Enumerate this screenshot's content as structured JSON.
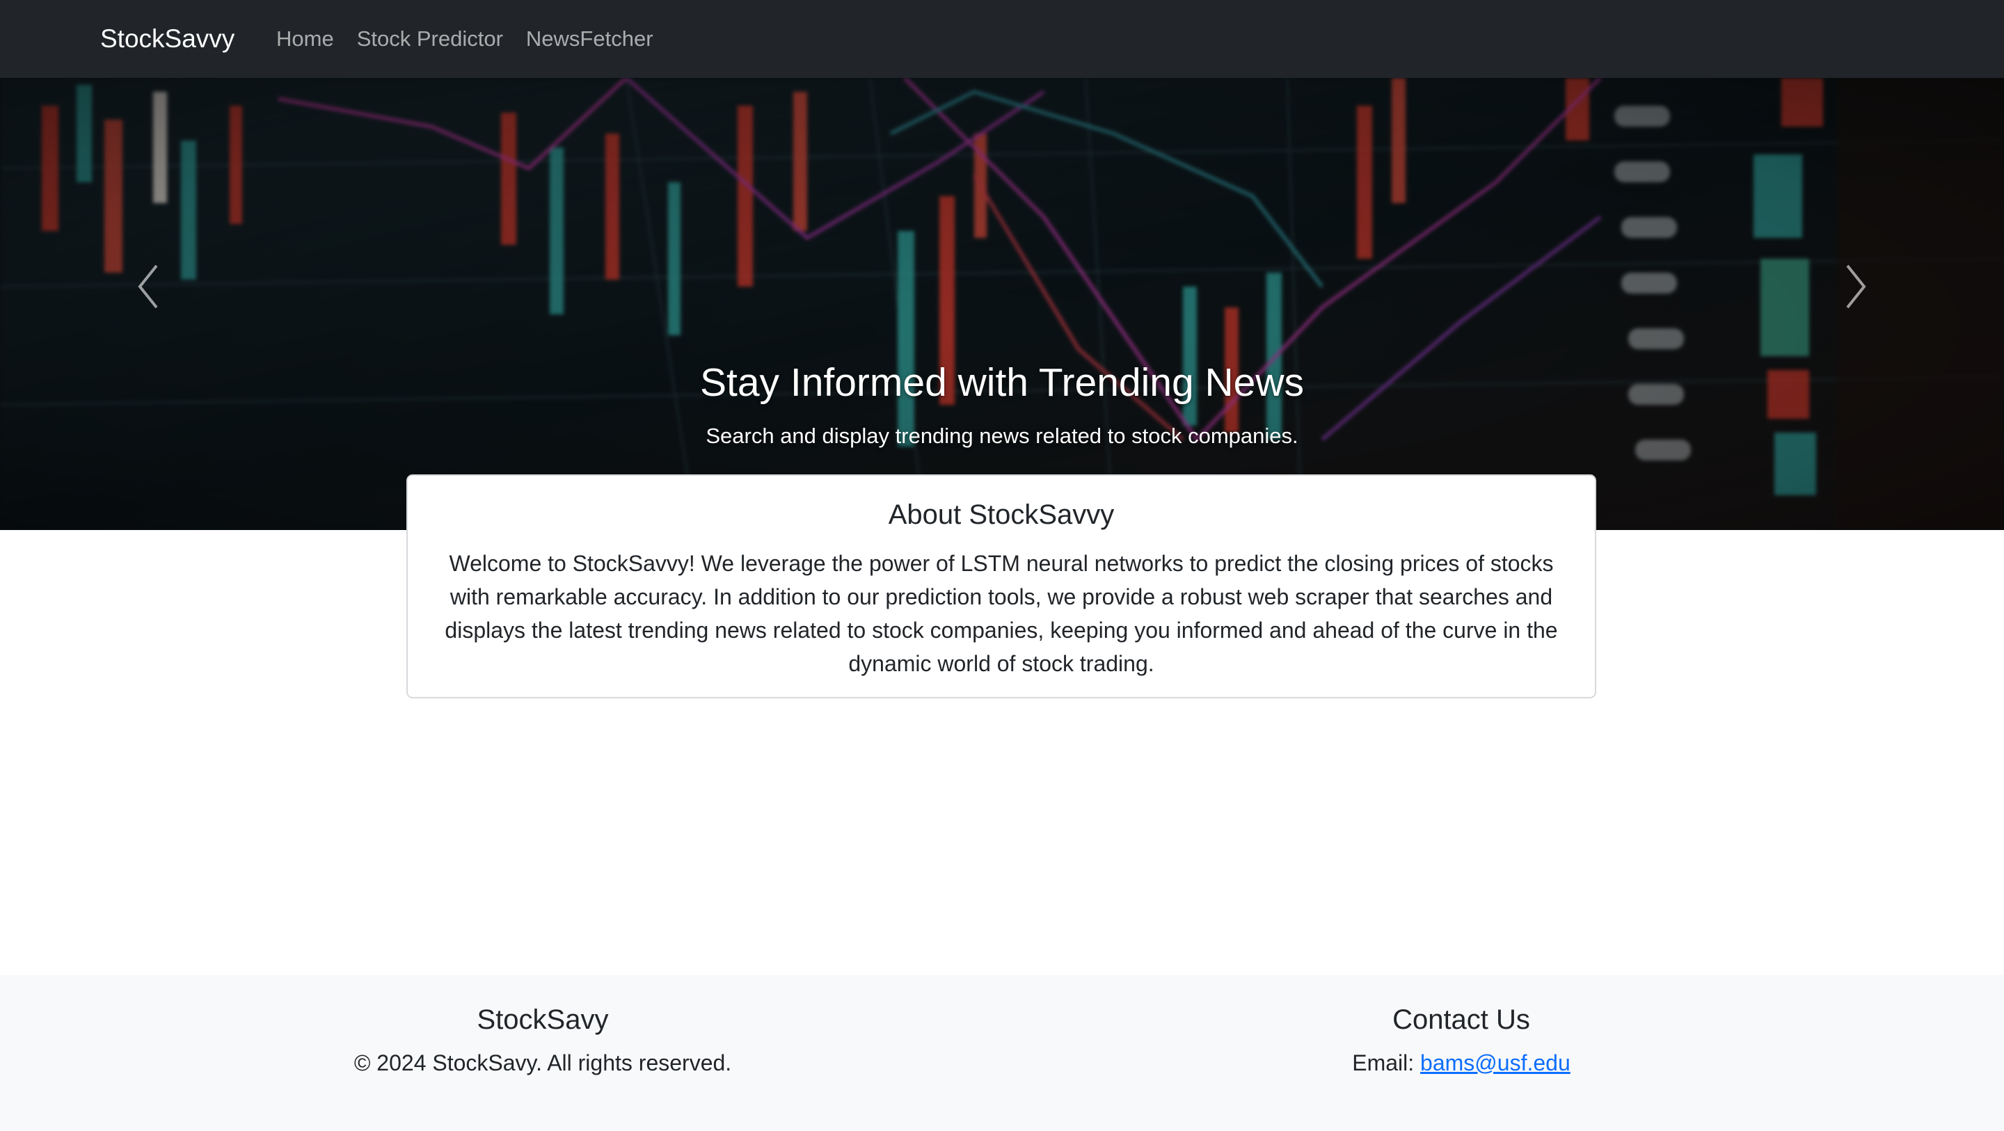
{
  "navbar": {
    "brand": "StockSavvy",
    "links": [
      {
        "label": "Home"
      },
      {
        "label": "Stock Predictor"
      },
      {
        "label": "NewsFetcher"
      }
    ]
  },
  "hero": {
    "title": "Stay Informed with Trending News",
    "subtitle": "Search and display trending news related to stock companies.",
    "prev_icon": "chevron-left-icon",
    "next_icon": "chevron-right-icon"
  },
  "about": {
    "title": "About StockSavvy",
    "text": "Welcome to StockSavvy! We leverage the power of LSTM neural networks to predict the closing prices of stocks with remarkable accuracy. In addition to our prediction tools, we provide a robust web scraper that searches and displays the latest trending news related to stock companies, keeping you informed and ahead of the curve in the dynamic world of stock trading."
  },
  "footer": {
    "left": {
      "heading": "StockSavy",
      "text": "© 2024 StockSavy. All rights reserved."
    },
    "right": {
      "heading": "Contact Us",
      "email_label": "Email: ",
      "email": "bams@usf.edu"
    }
  },
  "colors": {
    "navbar_bg": "#212529",
    "footer_bg": "#f8f9fa",
    "link": "#0d6efd"
  }
}
